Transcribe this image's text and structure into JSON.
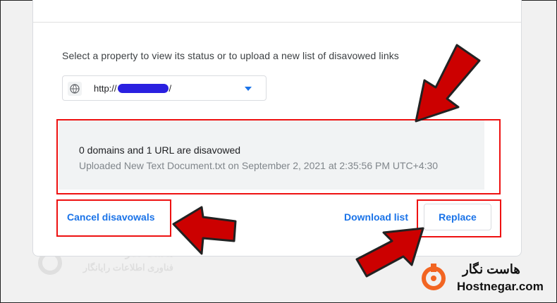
{
  "instruction": "Select a property to view its status or to upload a new list of disavowed links",
  "property_select": {
    "url_prefix": "http://",
    "url_suffix": "/",
    "icon": "globe-icon"
  },
  "status": {
    "title": "0 domains and 1 URL are disavowed",
    "detail": "Uploaded New Text Document.txt on September 2, 2021 at 2:35:56 PM UTC+4:30"
  },
  "actions": {
    "cancel_label": "Cancel disavowals",
    "download_label": "Download list",
    "replace_label": "Replace"
  },
  "watermark": {
    "line1": "هاست نگار",
    "line2": "فناوری اطلاعات رایانگار"
  },
  "branding": {
    "name_fa": "هاست نگار",
    "name_en": "Hostnegar.com"
  },
  "colors": {
    "accent": "#1a73e8",
    "highlight": "#e11111",
    "arrow": "#cc0000",
    "logo": "#f26522"
  }
}
